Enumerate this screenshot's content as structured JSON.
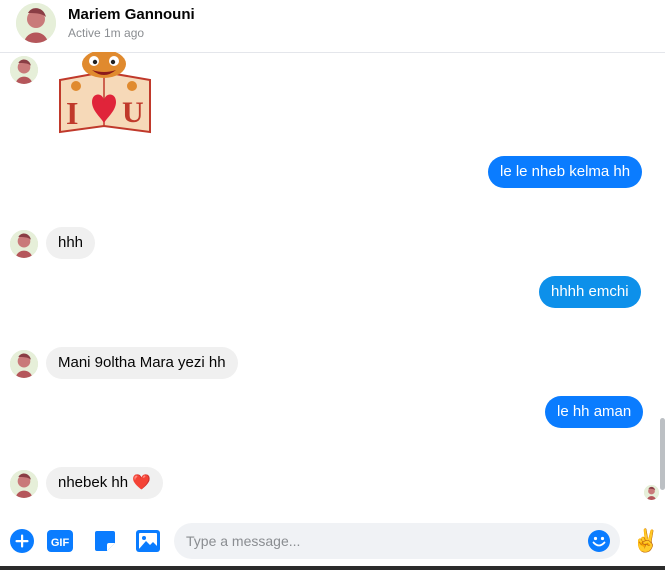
{
  "header": {
    "name": "Mariem Gannouni",
    "status": "Active 1m ago"
  },
  "messages": [
    {
      "from": "them",
      "type": "sticker",
      "sticker": "I ❤ U bear sticker"
    },
    {
      "from": "me",
      "text": "le le nheb kelma hh"
    },
    {
      "from": "them",
      "text": "hhh"
    },
    {
      "from": "me",
      "text": "hhhh emchi"
    },
    {
      "from": "them",
      "text": "Mani 9oltha Mara yezi hh"
    },
    {
      "from": "me",
      "text": "le hh aman"
    },
    {
      "from": "them",
      "text": "nhebek hh",
      "emoji": "❤️"
    }
  ],
  "composer": {
    "placeholder": "Type a message...",
    "value": "",
    "victory_emoji": "✌️"
  },
  "icons": [
    "plus-icon",
    "gif-icon",
    "sticker-icon",
    "image-icon",
    "emoji-icon",
    "victory-hand-icon"
  ],
  "colors": {
    "accent": "#0a7cff",
    "incoming_bubble": "#f0f0f0",
    "composer_bg": "#f0f2f5",
    "icon_blue": "#0a7cff"
  }
}
